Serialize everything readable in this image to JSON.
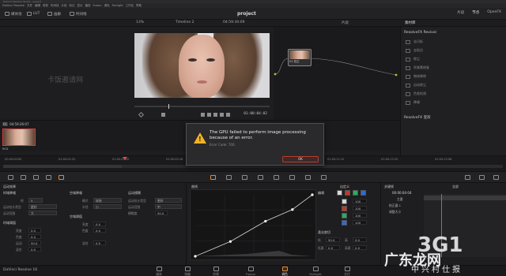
{
  "window": {
    "title": "DaVinci Resolve Studio - project",
    "menu": [
      "DaVinci Resolve",
      "文件",
      "编辑",
      "修剪",
      "时间线",
      "片段",
      "标记",
      "显示",
      "播放",
      "Fusion",
      "调色",
      "Fairlight",
      "工作区",
      "帮助"
    ]
  },
  "toolbar": {
    "media_pool": "媒体池",
    "lut": "LUT",
    "gallery": "画廊",
    "timeline": "时间线",
    "project": "project",
    "clips": "片段",
    "nodes": "节点",
    "openfx": "OpenFX"
  },
  "subbar": {
    "zoom": "13%",
    "timecode": "04:59:30:09",
    "timeline_name": "Timeline 2",
    "clip": "片段",
    "library": "素材库"
  },
  "viewer": {
    "timecode": "01:00:04:02"
  },
  "node": {
    "label": "01 校正"
  },
  "fx_panel": {
    "header": "ResolveFX Revival",
    "items": [
      "去闪烁",
      "去斑点",
      "除尘",
      "死像素修复",
      "物体移除",
      "自动除尘",
      "色差检测",
      "降噪"
    ],
    "header2": "ResolveFX 变形"
  },
  "clip": {
    "timecode": "04:59:26:07",
    "number": "01",
    "track": "V1",
    "name": "RED"
  },
  "ruler": {
    "ticks": [
      "00:00:00:00",
      "01:00:01:22",
      "01:00:03:20",
      "01:00:05:18",
      "01:00:07:16",
      "01:00:09:14",
      "01:00:11:12",
      "01:00:13:10",
      "01:00:15:08",
      "01:00:17:06",
      "01:00:19:04",
      "01:00:21:02"
    ]
  },
  "motion": {
    "header": "运动效果",
    "temporal_nr": "时域降噪",
    "frames_label": "帧",
    "frames_value": "5",
    "mode_label": "运动估计类型",
    "mode_value": "更好",
    "range_label": "运动范围",
    "range_value": "大",
    "spatial_nr": "空域降噪",
    "mode2_label": "模式",
    "mode2_value": "较快",
    "radius_label": "半径",
    "radius_value": "小",
    "temporal_thresholds": "时域阈值",
    "luma_label": "亮度",
    "luma_value": "0.0",
    "chroma_label": "色度",
    "chroma_value": "0.0",
    "blend_label": "运动",
    "blend_value": "50.0",
    "mix_label": "混合",
    "mix_value": "0.0",
    "spatial_thresholds": "空域阈值",
    "s_luma_value": "0.0",
    "s_chroma_value": "0.0",
    "s_blend_value": "0.0",
    "blur_header": "运动模糊",
    "blur_type_label": "运动估计类型",
    "blur_type_value": "更好",
    "blur_range_label": "运动范围",
    "blur_range_value": "中",
    "blur_amount_label": "模糊度",
    "blur_amount_value": "50.0"
  },
  "curves": {
    "header": "曲线",
    "mode": "自定义",
    "edit_label": "编辑",
    "soft_clip": "柔化裁切",
    "values": [
      "100",
      "100",
      "100",
      "100"
    ],
    "low_label": "低",
    "low_value": "50.0",
    "high_label": "高",
    "high_value": "0.0",
    "ls_label": "低柔",
    "ls_value": "0.0",
    "hs_label": "高柔",
    "hs_value": "0.0",
    "points": [
      [
        0.0,
        0.0
      ],
      [
        0.3,
        0.24
      ],
      [
        0.6,
        0.57
      ],
      [
        0.83,
        0.76
      ],
      [
        1.0,
        1.0
      ]
    ]
  },
  "keyframes": {
    "header": "关键帧",
    "all": "全部",
    "timecode": "00:00:04:04",
    "master": "主要",
    "tracks": [
      "校正器 1",
      "调整大小"
    ]
  },
  "pages": {
    "app_name": "DaVinci Resolve 16",
    "items": [
      "媒体",
      "快编",
      "剪辑",
      "Fusion",
      "调色",
      "Fairlight",
      "交付"
    ],
    "active": "调色"
  },
  "dialog": {
    "message": "The GPU failed to perform image processing because of an error.",
    "code": "Error Code: 700.",
    "ok": "OK"
  },
  "watermarks": {
    "faint": "卡饭邀请网",
    "brand_num": "3G1",
    "brand": "广东龙网",
    "brand_sub": "中兴村仕报"
  },
  "colors": {
    "accent": "#e08a3a",
    "warning": "#f0b323",
    "playhead": "#e04a4a",
    "ok_border": "#c0392b"
  }
}
